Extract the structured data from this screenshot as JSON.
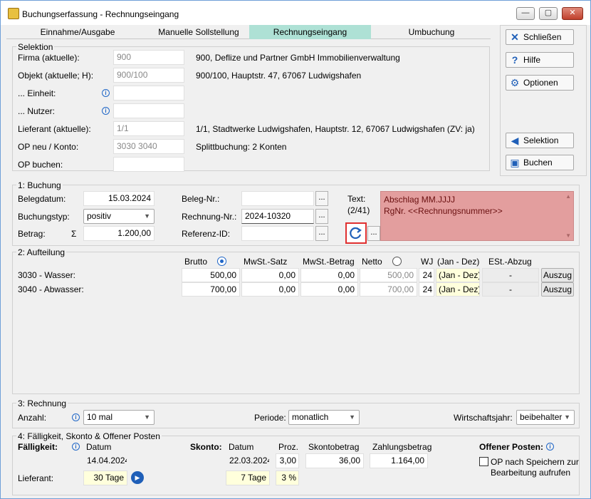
{
  "window": {
    "title": "Buchungserfassung - Rechnungseingang",
    "min": "—",
    "max": "▢",
    "close": "✕"
  },
  "tabs": [
    {
      "label": "Einnahme/Ausgabe"
    },
    {
      "label": "Manuelle Sollstellung"
    },
    {
      "label": "Rechnungseingang"
    },
    {
      "label": "Umbuchung"
    }
  ],
  "side": {
    "close": "Schließen",
    "help": "Hilfe",
    "options": "Optionen",
    "selection": "Selektion",
    "book": "Buchen"
  },
  "selektion": {
    "title": "Selektion",
    "rows": [
      {
        "label": "Firma (aktuelle):",
        "value": "900",
        "desc": "900,  Deflize und Partner GmbH Immobilienverwaltung"
      },
      {
        "label": "Objekt (aktuelle; H):",
        "value": "900/100",
        "desc": "900/100,  Hauptstr. 47, 67067 Ludwigshafen"
      },
      {
        "label": "... Einheit:",
        "value": "",
        "desc": ""
      },
      {
        "label": "... Nutzer:",
        "value": "",
        "desc": ""
      },
      {
        "label": "Lieferant (aktuelle):",
        "value": "1/1",
        "desc": "1/1,  Stadtwerke Ludwigshafen,  Hauptstr. 12, 67067 Ludwigshafen  (ZV: ja)"
      },
      {
        "label": "OP neu / Konto:",
        "value": "3030 3040",
        "desc": "Splittbuchung:  2 Konten"
      },
      {
        "label": "OP buchen:",
        "value": "",
        "desc": ""
      }
    ]
  },
  "buchung": {
    "title": "1: Buchung",
    "belegdatum_label": "Belegdatum:",
    "belegdatum": "15.03.2024",
    "buchungstyp_label": "Buchungstyp:",
    "buchungstyp": "positiv",
    "betrag_label": "Betrag:",
    "sigma": "Σ",
    "betrag": "1.200,00",
    "belegnr_label": "Beleg-Nr.:",
    "belegnr": "",
    "rechnungsnr_label": "Rechnung-Nr.:",
    "rechnungsnr": "2024-10320",
    "referenz_label": "Referenz-ID:",
    "referenz": "",
    "dots": "...",
    "text_label": "Text:",
    "text_count": "(2/41)",
    "text_line1": "Abschlag MM.JJJJ",
    "text_line2": "RgNr. <<Rechnungsnummer>>",
    "refresh_icon": "refresh-icon"
  },
  "aufteilung": {
    "title": "2: Aufteilung",
    "headers": {
      "brutto": "Brutto",
      "mwst_satz": "MwSt.-Satz",
      "mwst_betrag": "MwSt.-Betrag",
      "netto": "Netto",
      "wj": "WJ",
      "period": "(Jan - Dez)",
      "est": "ESt.-Abzug"
    },
    "rows": [
      {
        "name": "3030 - Wasser:",
        "brutto": "500,00",
        "satz": "0,00",
        "betrag": "0,00",
        "netto": "500,00",
        "wj": "24",
        "period": "(Jan - Dez)",
        "est": "-",
        "action": "Auszug"
      },
      {
        "name": "3040 - Abwasser:",
        "brutto": "700,00",
        "satz": "0,00",
        "betrag": "0,00",
        "netto": "700,00",
        "wj": "24",
        "period": "(Jan - Dez)",
        "est": "-",
        "action": "Auszug"
      }
    ]
  },
  "rechnung": {
    "title": "3: Rechnung",
    "anzahl_label": "Anzahl:",
    "anzahl": "10 mal",
    "periode_label": "Periode:",
    "periode": "monatlich",
    "wj_label": "Wirtschaftsjahr:",
    "wj": "beibehalter"
  },
  "faelligkeit": {
    "title": "4: Fälligkeit, Skonto & Offener Posten",
    "label": "Fälligkeit:",
    "datum_label": "Datum",
    "datum": "14.04.2024",
    "lieferant_label": "Lieferant:",
    "tage": "30 Tage",
    "skonto_label": "Skonto:",
    "skonto_datum_label": "Datum",
    "skonto_datum": "22.03.2024",
    "proz_label": "Proz.",
    "proz": "3,00",
    "skontobetrag_label": "Skontobetrag",
    "skontobetrag": "36,00",
    "zahlungsbetrag_label": "Zahlungsbetrag",
    "zahlungsbetrag": "1.164,00",
    "skonto_tage": "7 Tage",
    "skonto_proz": "3 %",
    "op_label": "Offener Posten:",
    "op_check_line1": "OP nach Speichern zur",
    "op_check_line2": "Bearbeitung aufrufen"
  }
}
